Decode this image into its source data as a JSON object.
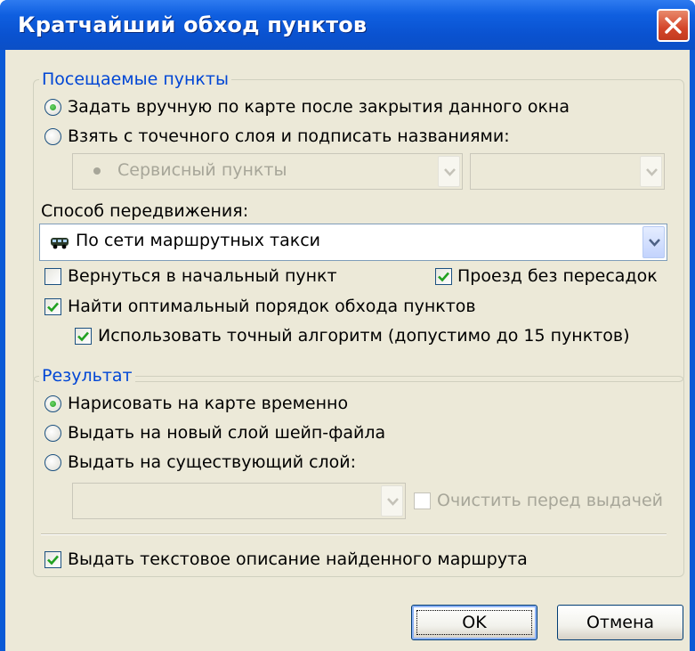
{
  "window": {
    "title": "Кратчайший обход пунктов"
  },
  "visited_points": {
    "legend": "Посещаемые пункты",
    "radio_manual": {
      "label": "Задать вручную по карте после закрытия данного окна",
      "selected": true
    },
    "radio_layer": {
      "label": "Взять с точечного слоя и подписать названиями:",
      "selected": false
    },
    "layer_combo": {
      "value": "Сервисный пункты",
      "icon": "bullet-dot-icon"
    },
    "name_combo": {
      "value": ""
    },
    "movement_label": "Способ передвижения:",
    "movement_combo": {
      "value": "По сети маршрутных такси",
      "icon": "minibus-icon"
    },
    "return_to_start": {
      "label": "Вернуться в начальный пункт",
      "checked": false
    },
    "no_transfers": {
      "label": "Проезд без пересадок",
      "checked": true
    },
    "find_optimal_order": {
      "label": "Найти оптимальный порядок обхода пунктов",
      "checked": true
    },
    "exact_algorithm": {
      "label": "Использовать точный алгоритм (допустимо до 15 пунктов)",
      "checked": true
    }
  },
  "result": {
    "legend": "Результат",
    "radio_draw_temp": {
      "label": "Нарисовать на карте временно",
      "selected": true
    },
    "radio_new_layer": {
      "label": "Выдать на новый слой шейп-файла",
      "selected": false
    },
    "radio_existing_layer": {
      "label": "Выдать на существующий слой:",
      "selected": false
    },
    "existing_layer_combo": {
      "value": ""
    },
    "clear_before_output": {
      "label": "Очистить перед выдачей",
      "checked": false
    },
    "text_description": {
      "label": "Выдать текстовое описание найденного маршрута",
      "checked": true
    }
  },
  "buttons": {
    "ok": "OK",
    "cancel": "Отмена"
  },
  "colors": {
    "title_bar": "#0a52d0",
    "dialog_bg": "#ece9d8",
    "group_legend": "#0046d5",
    "check_mark": "#21a121",
    "disabled_text": "#a7a699"
  }
}
